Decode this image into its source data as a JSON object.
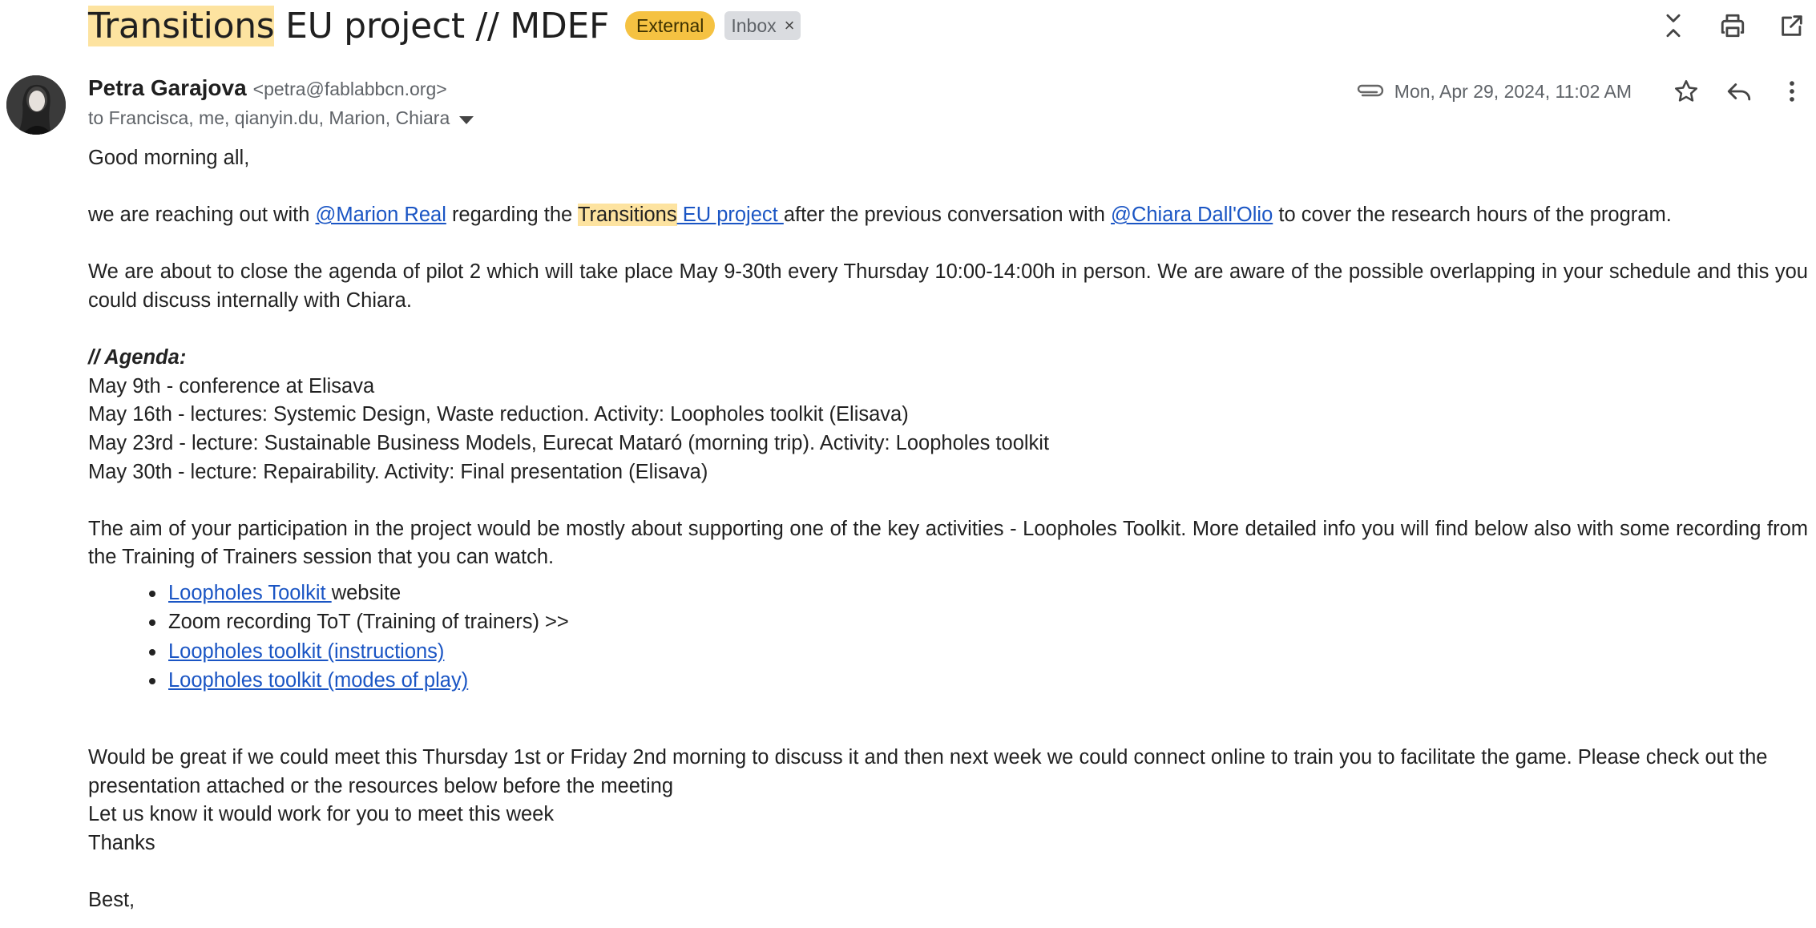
{
  "subject": {
    "highlight": "Transitions",
    "rest": " EU project // MDEF",
    "labels": {
      "external": "External",
      "inbox": "Inbox",
      "inbox_remove": "×"
    }
  },
  "sender": {
    "name": "Petra Garajova",
    "email": "<petra@fablabbcn.org>",
    "recipients": "to Francisca, me, qianyin.du, Marion, Chiara",
    "date": "Mon, Apr 29, 2024, 11:02 AM"
  },
  "body": {
    "greeting": "Good morning all,",
    "p1": {
      "t1": "we are reaching out with ",
      "mention1": "@Marion Real",
      "t2": " regarding the ",
      "hl": "Transitions",
      "link": " EU project ",
      "t3": "after the previous conversation with ",
      "mention2": "@Chiara Dall'Olio",
      "t4": " to cover the research hours of the program."
    },
    "p2": "We are about to close the agenda of pilot 2 which will take place May 9-30th every Thursday 10:00-14:00h in person. We are aware of the possible overlapping in your schedule and this you could discuss internally with Chiara.",
    "agenda_heading": "// Agenda:",
    "agenda": [
      "May 9th - conference at Elisava",
      "May 16th - lectures: Systemic Design, Waste reduction. Activity: Loopholes toolkit (Elisava)",
      "May 23rd - lecture: Sustainable Business Models, Eurecat Mataró (morning trip). Activity: Loopholes toolkit",
      "May 30th - lecture: Repairability. Activity: Final presentation (Elisava)"
    ],
    "p3": "The aim of your participation in the project would be mostly about supporting one of the key activities - Loopholes Toolkit. More detailed info you will find below also with some recording from the Training of Trainers session that you can watch.",
    "resources": {
      "r1_link": "Loopholes Toolkit ",
      "r1_text": "website",
      "r2_text": "Zoom recording ToT (Training of trainers) >>",
      "r3_link": "Loopholes toolkit (instructions)",
      "r4_link": "Loopholes toolkit (modes of play)"
    },
    "p4": "Would be great if we could meet this Thursday 1st or Friday 2nd morning to discuss it and then next week we could connect online to train you to facilitate the game. Please check out the presentation attached or the resources below before the meeting",
    "p5": "Let us know it would work for you to meet this week",
    "thanks": "Thanks",
    "signoff": "Best,"
  },
  "colors": {
    "link": "#1a55c4",
    "highlight": "#fde3a0",
    "external_label": "#f5c242",
    "inbox_label": "#dadce0"
  },
  "icons": [
    "collapse-icon",
    "print-icon",
    "open-in-new-icon",
    "attachment-icon",
    "star-icon",
    "reply-icon",
    "more-vert-icon"
  ]
}
